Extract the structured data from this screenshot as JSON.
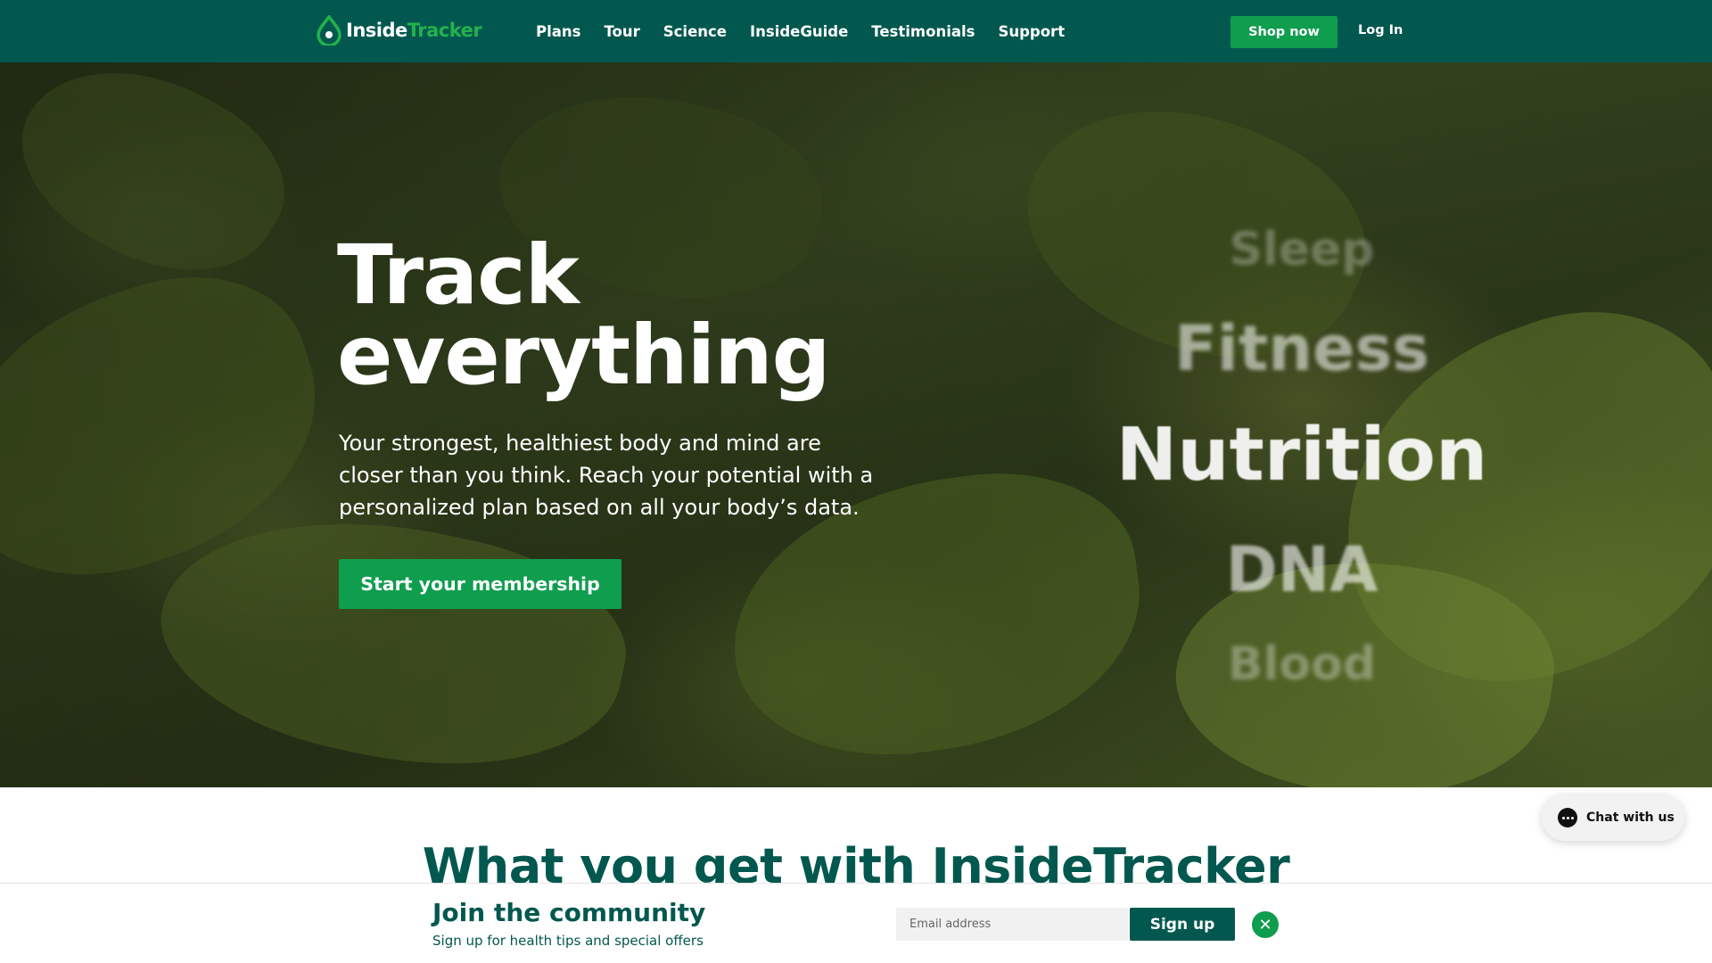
{
  "header": {
    "logo": {
      "part1": "Inside",
      "part2": "Tracker"
    },
    "nav": [
      "Plans",
      "Tour",
      "Science",
      "InsideGuide",
      "Testimonials",
      "Support"
    ],
    "shop_label": "Shop now",
    "login_label": "Log In"
  },
  "hero": {
    "title_line1": "Track",
    "title_line2": "everything",
    "subtitle": "Your strongest, healthiest body and mind are closer than you think. Reach your potential with a personalized plan based on all your body’s data.",
    "cta_label": "Start your membership",
    "rotating_words": [
      "Sleep",
      "Fitness",
      "Nutrition",
      "DNA",
      "Blood"
    ]
  },
  "section": {
    "title": "What you get with InsideTracker"
  },
  "chat": {
    "label": "Chat with us"
  },
  "newsletter": {
    "title": "Join the community",
    "subtitle": "Sign up for health tips and special offers",
    "email_placeholder": "Email address",
    "signup_label": "Sign up"
  },
  "colors": {
    "brand_dark": "#02584f",
    "brand_green": "#0f9d4e",
    "logo_accent": "#22b24c"
  }
}
